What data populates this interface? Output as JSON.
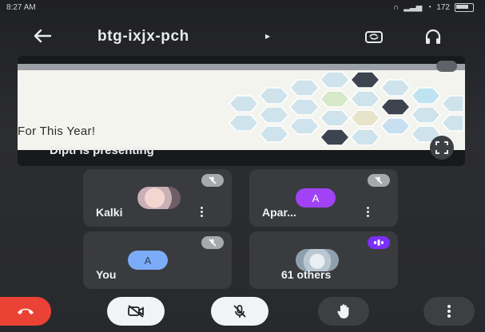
{
  "status_bar": {
    "time": "8:27 AM",
    "battery_text": "172"
  },
  "header": {
    "title": "btg-ixjx-pch",
    "title_caret": "▸"
  },
  "presentation": {
    "slide_text": "For This Year!",
    "presenter_caption": "Dipti is presenting"
  },
  "participants": [
    {
      "name": "Kalki",
      "avatar": "photo"
    },
    {
      "name": "Apar...",
      "avatar": "letter",
      "letter": "A",
      "color": "#a142f4"
    },
    {
      "name": "You",
      "avatar": "letter",
      "letter": "A",
      "color": "#7cacf8"
    },
    {
      "name": "61 others",
      "avatar": "photo",
      "badge_color": "#7b2ff7"
    }
  ],
  "colors": {
    "end_call": "#ea4335",
    "background": "#2a2b2f",
    "tile": "#3a3b3f"
  },
  "icons": [
    "back-arrow-icon",
    "switch-camera-icon",
    "headphones-icon",
    "expand-icon",
    "mic-off-icon",
    "camera-off-icon",
    "raise-hand-icon",
    "more-options-icon",
    "end-call-icon"
  ]
}
